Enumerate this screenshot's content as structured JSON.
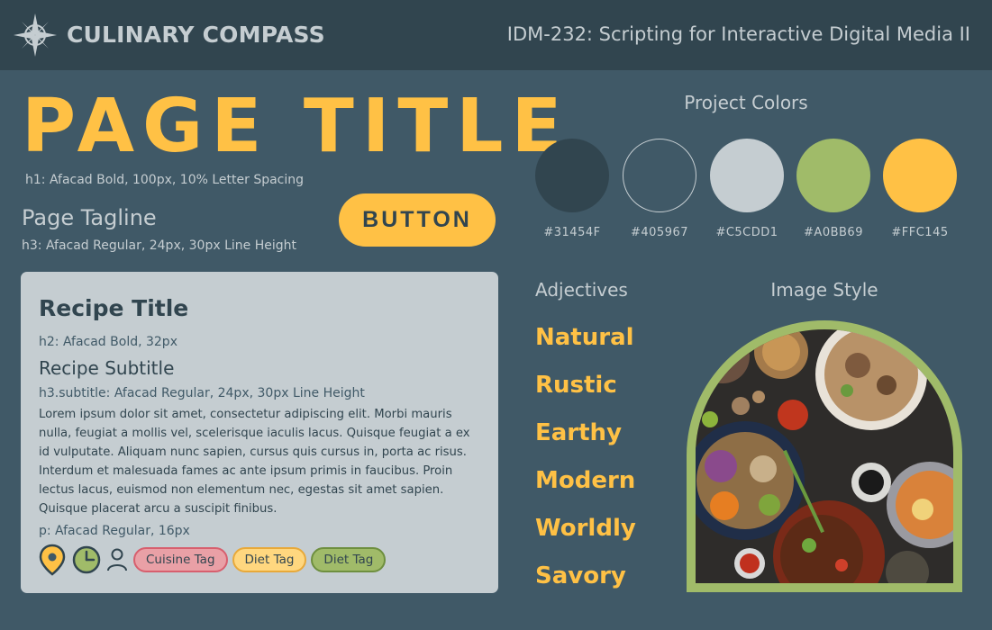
{
  "header": {
    "brand": "CULINARY COMPASS",
    "logo_icon": "compass-star-icon",
    "course": "IDM-232: Scripting for Interactive Digital Media II"
  },
  "typography": {
    "page_title": "PAGE TITLE",
    "page_title_note": "h1: Afacad Bold, 100px, 10% Letter Spacing",
    "tagline": "Page Tagline",
    "tagline_note": "h3: Afacad Regular, 24px, 30px Line Height",
    "button_label": "BUTTON"
  },
  "recipe_card": {
    "title": "Recipe Title",
    "title_note": "h2: Afacad Bold, 32px",
    "subtitle": "Recipe Subtitle",
    "subtitle_note": "h3.subtitle: Afacad Regular, 24px, 30px Line Height",
    "body": "Lorem ipsum dolor sit amet, consectetur adipiscing elit. Morbi mauris nulla, feugiat a mollis vel, scelerisque iaculis lacus. Quisque feugiat a ex id vulputate. Aliquam nunc sapien, cursus quis cursus in, porta ac risus. Interdum et malesuada fames ac ante ipsum primis in faucibus. Proin lectus lacus, euismod non elementum nec, egestas sit amet sapien. Quisque placerat arcu a suscipit finibus.",
    "body_note": "p: Afacad Regular, 16px",
    "icons": [
      "location-pin-icon",
      "clock-icon",
      "person-icon"
    ],
    "tags": [
      {
        "label": "Cuisine Tag",
        "bg": "#E9A0A6",
        "border": "#D75F6E"
      },
      {
        "label": "Diet Tag",
        "bg": "#FFD77F",
        "border": "#E8A93A"
      },
      {
        "label": "Diet Tag",
        "bg": "#A0BB69",
        "border": "#6E8F3F"
      }
    ]
  },
  "project_colors": {
    "title": "Project Colors",
    "swatches": [
      {
        "hex": "#31454F"
      },
      {
        "hex": "#405967"
      },
      {
        "hex": "#C5CDD1"
      },
      {
        "hex": "#A0BB69"
      },
      {
        "hex": "#FFC145"
      }
    ]
  },
  "adjectives": {
    "title": "Adjectives",
    "items": [
      "Natural",
      "Rustic",
      "Earthy",
      "Modern",
      "Worldly",
      "Savory"
    ]
  },
  "image_style": {
    "title": "Image Style",
    "frame_color": "#A0BB69",
    "subject": "food-spread-photo"
  }
}
